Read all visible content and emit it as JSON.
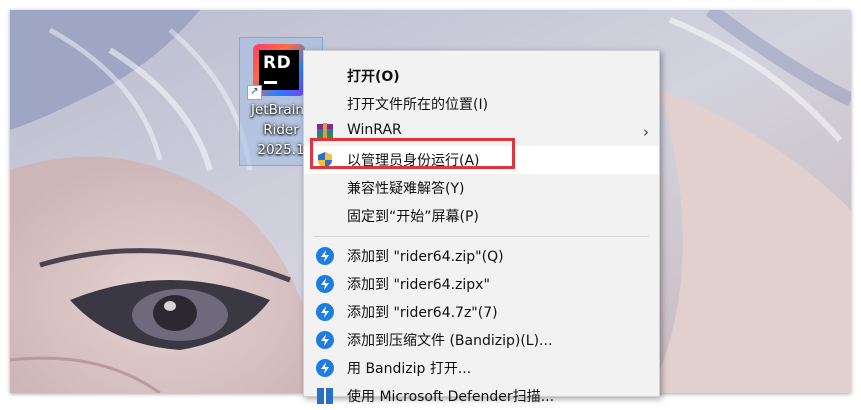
{
  "desktop_icon": {
    "logo_text": "RD",
    "label_lines": [
      "JetBrains",
      "Rider",
      "2025.1"
    ]
  },
  "context_menu": {
    "items": [
      {
        "label": "打开(O)",
        "icon": "none",
        "bold": true
      },
      {
        "label": "打开文件所在的位置(I)",
        "icon": "none"
      },
      {
        "label": "WinRAR",
        "icon": "winrar-icon",
        "submenu": true
      },
      {
        "label": "以管理员身份运行(A)",
        "icon": "uac-shield-icon",
        "highlighted": true
      },
      {
        "label": "兼容性疑难解答(Y)",
        "icon": "none"
      },
      {
        "label": "固定到“开始”屏幕(P)",
        "icon": "none"
      },
      {
        "label": "添加到 \"rider64.zip\"(Q)",
        "icon": "bandizip-icon"
      },
      {
        "label": "添加到 \"rider64.zipx\"",
        "icon": "bandizip-icon"
      },
      {
        "label": "添加到 \"rider64.7z\"(7)",
        "icon": "bandizip-icon"
      },
      {
        "label": "添加到压缩文件 (Bandizip)(L)...",
        "icon": "bandizip-icon"
      },
      {
        "label": "用 Bandizip 打开...",
        "icon": "bandizip-icon"
      },
      {
        "label": "使用 Microsoft Defender扫描...",
        "icon": "defender-icon"
      }
    ],
    "submenu_arrow": "›"
  },
  "colors": {
    "highlight_border": "#e0353b",
    "menu_bg": "#f2f2f2",
    "bandizip_blue": "#1f7de0"
  }
}
